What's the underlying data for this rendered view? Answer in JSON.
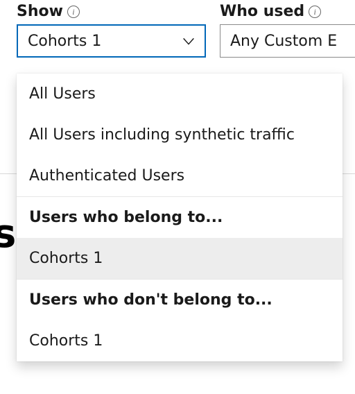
{
  "filters": {
    "show": {
      "label": "Show",
      "selected": "Cohorts 1",
      "options": [
        {
          "label": "All Users",
          "kind": "item"
        },
        {
          "label": "All Users including synthetic traffic",
          "kind": "item"
        },
        {
          "label": "Authenticated Users",
          "kind": "item"
        },
        {
          "label": "Users who belong to...",
          "kind": "header"
        },
        {
          "label": "Cohorts 1",
          "kind": "item",
          "selected": true
        },
        {
          "label": "Users who don't belong to...",
          "kind": "header"
        },
        {
          "label": "Cohorts 1",
          "kind": "item"
        }
      ]
    },
    "who_used": {
      "label": "Who used",
      "selected": "Any Custom E"
    }
  },
  "bg_char": "s"
}
